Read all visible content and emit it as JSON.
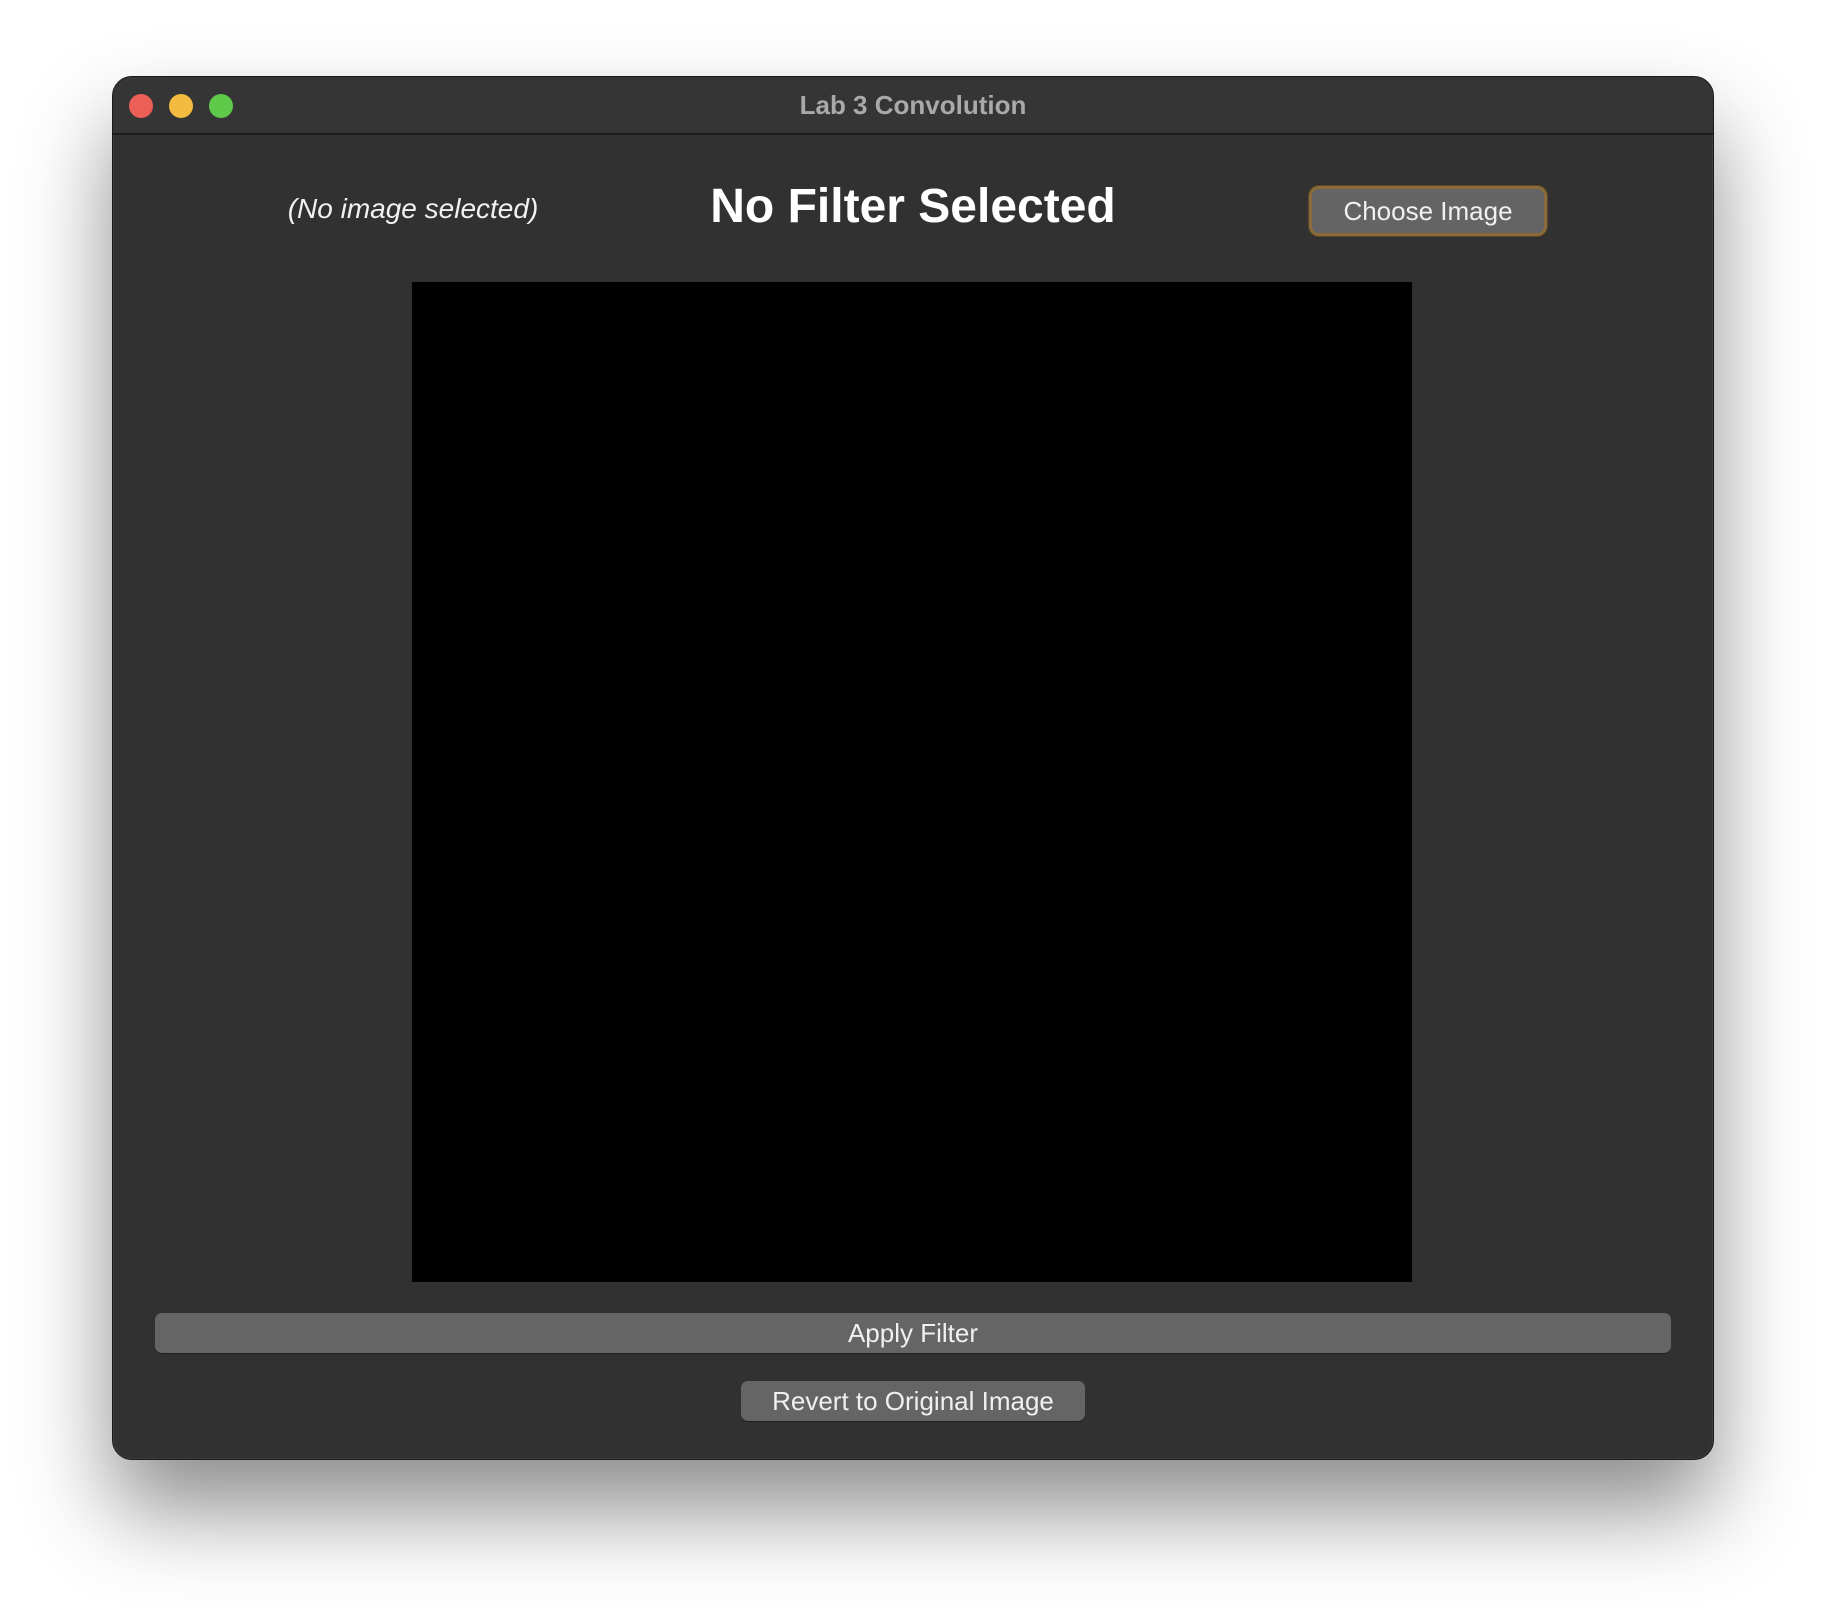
{
  "window": {
    "title": "Lab 3 Convolution"
  },
  "header": {
    "image_status": "(No image selected)",
    "filter_title": "No Filter Selected",
    "choose_image_label": "Choose Image"
  },
  "actions": {
    "apply_filter_label": "Apply Filter",
    "revert_label": "Revert to Original Image"
  },
  "colors": {
    "window_background": "#313131",
    "image_area": "#000000",
    "button_background": "#656565",
    "focus_ring": "#8a6a3a",
    "close": "#ec5f57",
    "minimize": "#f3bc40",
    "zoom": "#5fc94a"
  }
}
